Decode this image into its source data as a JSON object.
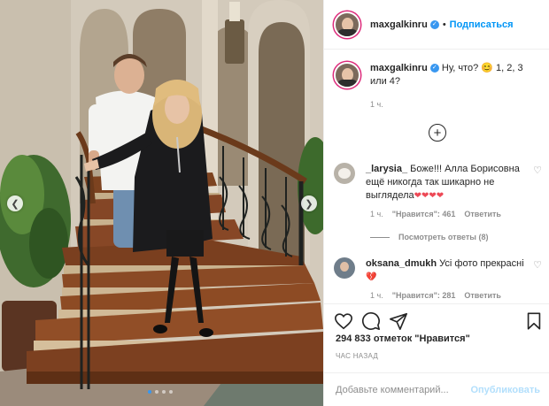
{
  "post": {
    "username": "maxgalkinru",
    "follow_label": "Подписаться",
    "separator": "•",
    "caption_text": "Ну, что? 😊 1, 2, 3 или 4?",
    "caption_time": "1 ч.",
    "likes_text": "294 833 отметок \"Нравится\"",
    "posted_ago": "ЧАС НАЗАД",
    "carousel_count": 4,
    "carousel_active": 1
  },
  "comments": [
    {
      "username": "_larysia_",
      "text": "Боже!!! Алла Борисовна ещё никогда так шикарно не выглядела",
      "hearts": "❤❤❤❤",
      "time": "1 ч.",
      "likes": "\"Нравится\": 461",
      "reply": "Ответить"
    },
    {
      "username": "oksana_dmukh",
      "text": "Усі фото прекрасні",
      "hearts": "💔",
      "time": "1 ч.",
      "likes": "\"Нравится\": 281",
      "reply": "Ответить"
    }
  ],
  "view_replies": "Посмотреть ответы (8)",
  "comment_box": {
    "placeholder": "Добавьте комментарий...",
    "publish_label": "Опубликовать"
  },
  "icons": {
    "verified": "verified-badge-icon",
    "like": "heart-icon",
    "comment": "comment-icon",
    "share": "paper-plane-icon",
    "save": "bookmark-icon",
    "load_more": "plus-circle-icon"
  },
  "colors": {
    "accent": "#0095f6",
    "verified": "#3897f0",
    "heart": "#ed4956",
    "muted": "#8e8e8e"
  }
}
